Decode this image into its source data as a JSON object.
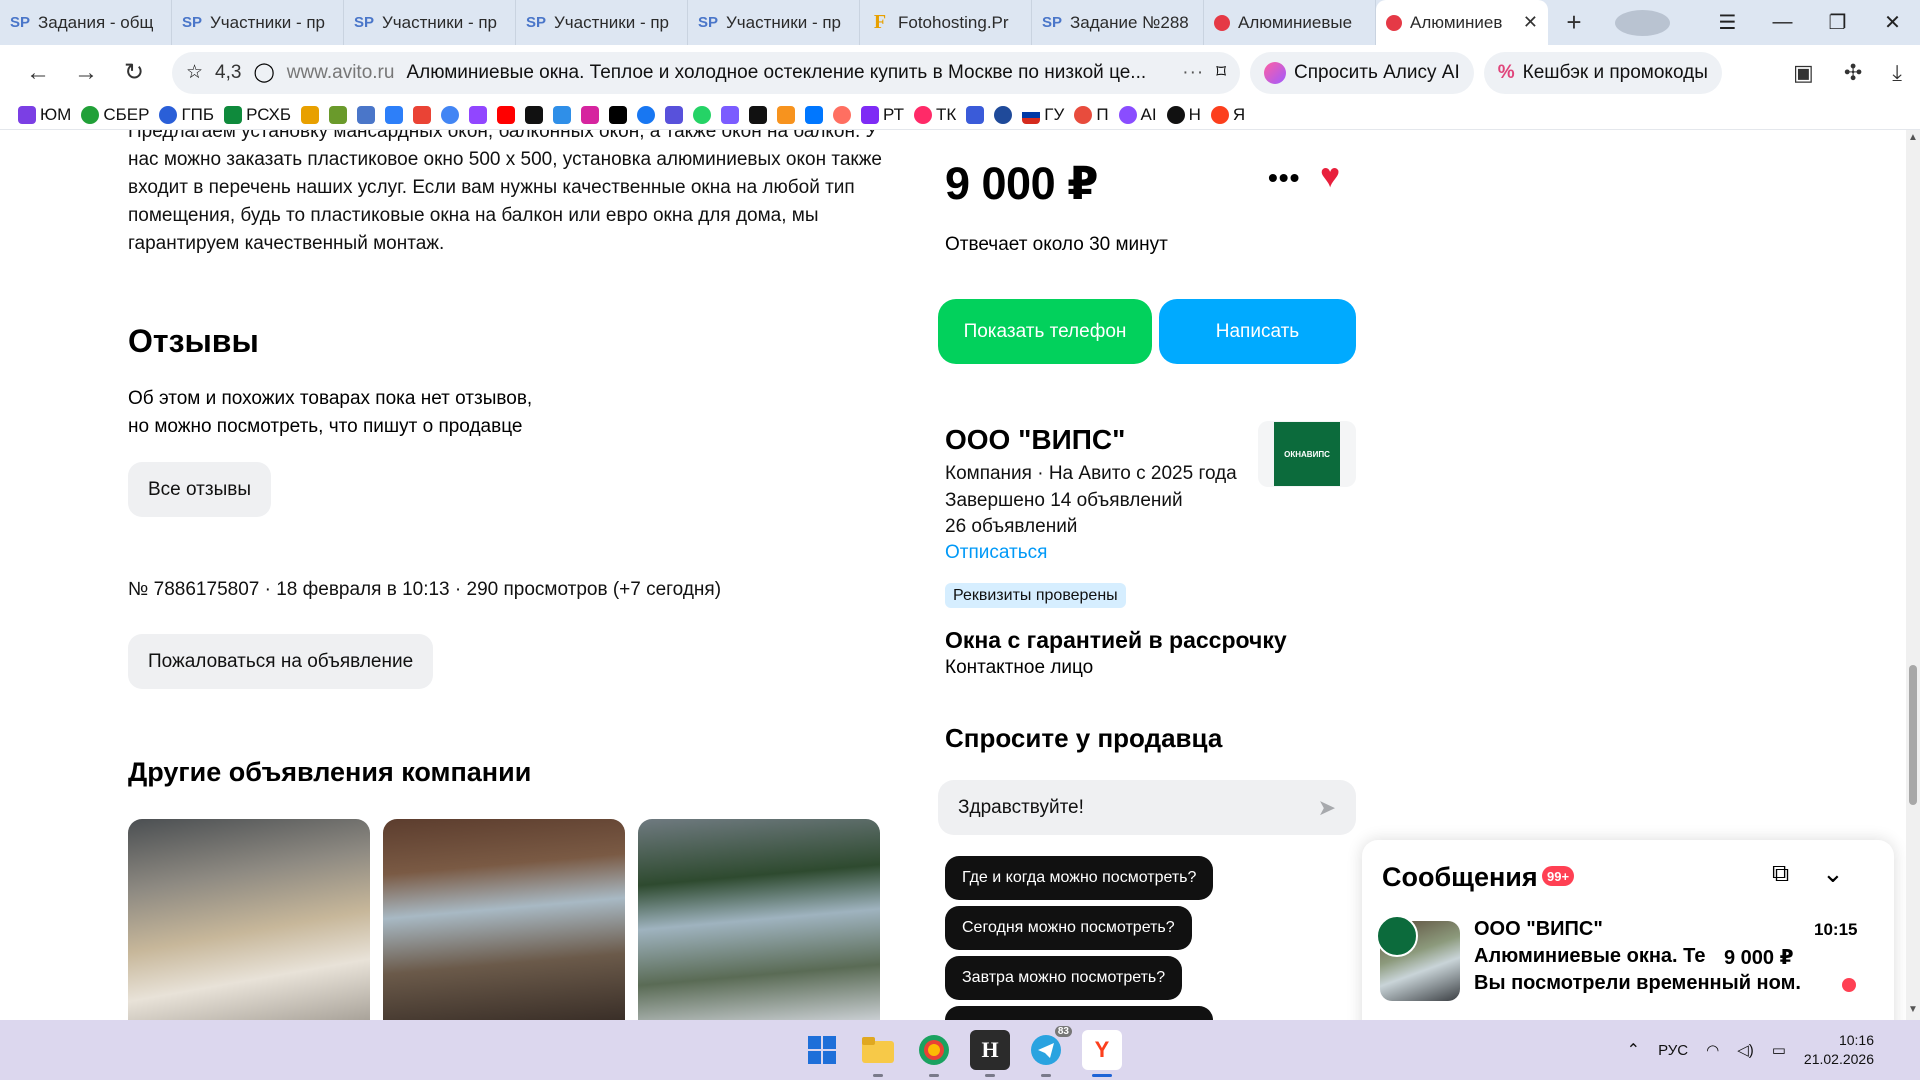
{
  "browser": {
    "tabs": [
      {
        "icon": "SP",
        "label": "Задания - общ"
      },
      {
        "icon": "SP",
        "label": "Участники - пр"
      },
      {
        "icon": "SP",
        "label": "Участники - пр"
      },
      {
        "icon": "SP",
        "label": "Участники - пр"
      },
      {
        "icon": "SP",
        "label": "Участники - пр"
      },
      {
        "icon": "F",
        "label": "Fotohosting.Pr"
      },
      {
        "icon": "SP",
        "label": "Задание №288"
      },
      {
        "icon": "",
        "label": "Алюминиевые"
      },
      {
        "icon": "",
        "label": "Алюминиев"
      }
    ],
    "rating": "4,3",
    "domain": "www.avito.ru",
    "page_title": "Алюминиевые окна. Теплое и холодное остекление купить в Москве по низкой це...",
    "alice_label": "Спросить Алису AI",
    "cashback_label": "Кешбэк и промокоды",
    "bookmarks": [
      "ЮМ",
      "СБЕР",
      "ГПБ",
      "РСХБ",
      "",
      "",
      "",
      "",
      "",
      "",
      "",
      "",
      "",
      "",
      "",
      "",
      "",
      "",
      "",
      "",
      "",
      "",
      "РТ",
      "ТК",
      "",
      "ГУ",
      "П",
      "AI",
      "Н",
      "Я"
    ]
  },
  "listing": {
    "description": "Предлагаем установку мансардных окон, балконных окон, а также окон на балкон. У нас можно заказать пластиковое окно 500 х 500, установка алюминиевых окон также входит в перечень наших услуг. Если вам нужны качественные окна на любой тип помещения, будь то пластиковые окна на балкон или евро окна для дома, мы гарантируем качественный монтаж.",
    "reviews_title": "Отзывы",
    "reviews_line1": "Об этом и похожих товарах пока нет отзывов,",
    "reviews_line2": "но можно посмотреть, что пишут о продавце",
    "all_reviews_button": "Все отзывы",
    "meta": "№ 7886175807 · 18 февраля в 10:13 · 290 просмотров (+7 сегодня)",
    "report_button": "Пожаловаться на объявление",
    "other_title": "Другие объявления компании"
  },
  "sidebar": {
    "price": "9 000 ₽",
    "responds": "Отвечает около 30 минут",
    "show_phone": "Показать телефон",
    "write": "Написать",
    "seller_name": "ООО \"ВИПС\"",
    "seller_type": "Компания · На Авито с 2025 года",
    "completed": "Завершено 14 объявлений",
    "ads_count": "26 объявлений",
    "unsubscribe": "Отписаться",
    "verified": "Реквизиты проверены",
    "shop_title": "Окна с гарантией в рассрочку",
    "contact": "Контактное лицо",
    "ask_title": "Спросите у продавца",
    "ask_value": "Здравствуйте!",
    "chips": [
      "Где и когда можно посмотреть?",
      "Сегодня можно посмотреть?",
      "Завтра можно посмотреть?"
    ],
    "logo_text": "ОКНАВИПС"
  },
  "messages": {
    "title": "Сообщения",
    "badge": "99+",
    "sender": "ООО \"ВИПС\"",
    "time": "10:15",
    "item": "Алюминиевые окна. Теп...",
    "price": "9 000 ₽",
    "preview": "Вы посмотрели временный ном..."
  },
  "taskbar": {
    "lang": "РУС",
    "time": "10:16",
    "date": "21.02.2026",
    "telegram_badge": "83"
  },
  "colors": {
    "green": "#02d15c",
    "blue": "#00aaff",
    "heart": "#e8203c",
    "link": "#0099f7"
  }
}
